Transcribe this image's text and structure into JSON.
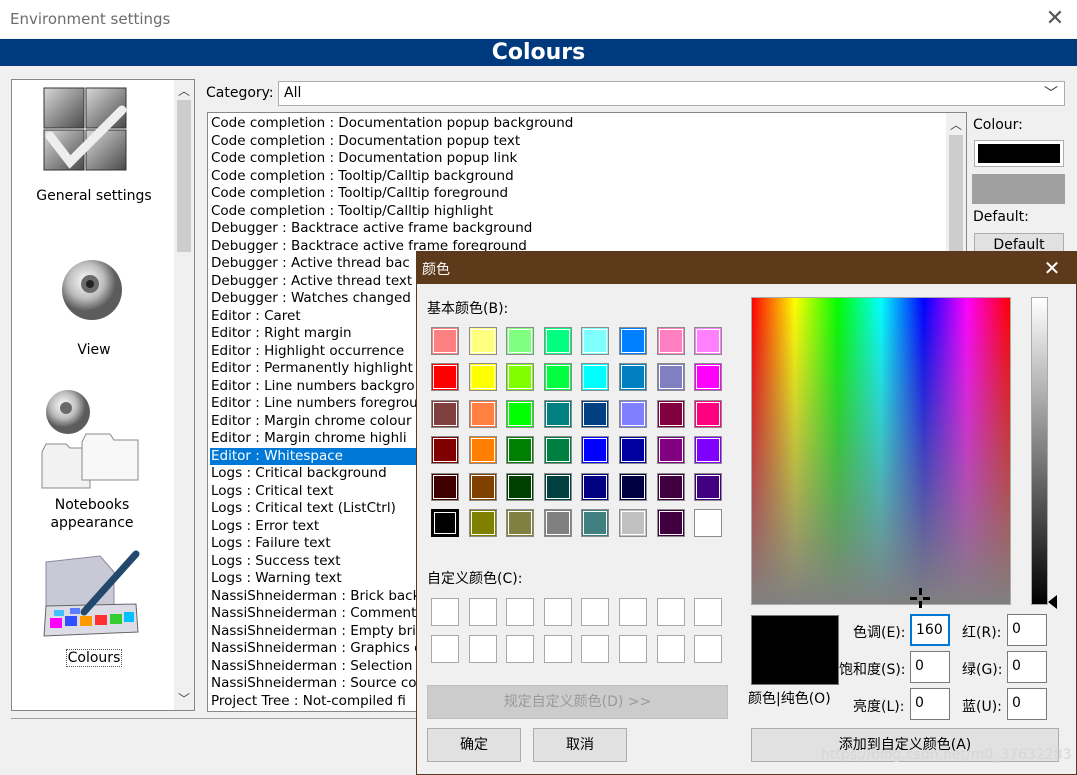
{
  "window": {
    "title": "Environment settings",
    "close_icon": "close-icon"
  },
  "header": {
    "title": "Colours"
  },
  "sidebar": {
    "items": [
      {
        "label": "General settings",
        "icon": "settings-check-icon"
      },
      {
        "label": "View",
        "icon": "eye-icon"
      },
      {
        "label": "Notebooks appearance",
        "icon": "notebooks-icon"
      },
      {
        "label": "Colours",
        "icon": "palette-icon"
      }
    ]
  },
  "category": {
    "label": "Category:",
    "value": "All"
  },
  "list": {
    "items": [
      "Code completion : Documentation popup background",
      "Code completion : Documentation popup text",
      "Code completion : Documentation popup link",
      "Code completion : Tooltip/Calltip background",
      "Code completion : Tooltip/Calltip foreground",
      "Code completion : Tooltip/Calltip highlight",
      "Debugger : Backtrace active frame background",
      "Debugger : Backtrace active frame foreground",
      "Debugger : Active thread bac",
      "Debugger : Active thread text",
      "Debugger : Watches changed",
      "Editor : Caret",
      "Editor : Right margin",
      "Editor : Highlight occurrence",
      "Editor : Permanently highlight",
      "Editor : Line numbers backgro",
      "Editor : Line numbers foregrou",
      "Editor : Margin chrome colour",
      "Editor : Margin chrome highli",
      "Editor : Whitespace",
      "Logs : Critical background",
      "Logs : Critical text",
      "Logs : Critical text (ListCtrl)",
      "Logs : Error text",
      "Logs : Failure text",
      "Logs : Success text",
      "Logs : Warning text",
      "NassiShneiderman : Brick back",
      "NassiShneiderman : Comment",
      "NassiShneiderman : Empty bri",
      "NassiShneiderman : Graphics c",
      "NassiShneiderman : Selection",
      "NassiShneiderman : Source co",
      "Project Tree : Not-compiled fi"
    ],
    "selected_index": 19
  },
  "right_panel": {
    "colour_label": "Colour:",
    "colour_value": "#000000",
    "default_label": "Default:",
    "default_button": "Default"
  },
  "color_dialog": {
    "title": "颜色",
    "basic_label": "基本颜色(B):",
    "custom_label": "自定义颜色(C):",
    "define_button": "规定自定义颜色(D) >>",
    "ok_button": "确定",
    "cancel_button": "取消",
    "add_button": "添加到自定义颜色(A)",
    "preview_label": "颜色|纯色(O)",
    "hue_label": "色调(E):",
    "hue_value": "160",
    "sat_label": "饱和度(S):",
    "sat_value": "0",
    "lum_label": "亮度(L):",
    "lum_value": "0",
    "red_label": "红(R):",
    "red_value": "0",
    "green_label": "绿(G):",
    "green_value": "0",
    "blue_label": "蓝(U):",
    "blue_value": "0",
    "watermark": "https://blog.csdn.net/m0_37632283",
    "basic_colors": [
      "#ff8080",
      "#ffff80",
      "#80ff80",
      "#00ff80",
      "#80ffff",
      "#0080ff",
      "#ff80c0",
      "#ff80ff",
      "#ff0000",
      "#ffff00",
      "#80ff00",
      "#00ff40",
      "#00ffff",
      "#0080c0",
      "#8080c0",
      "#ff00ff",
      "#804040",
      "#ff8040",
      "#00ff00",
      "#008080",
      "#004080",
      "#8080ff",
      "#800040",
      "#ff0080",
      "#800000",
      "#ff8000",
      "#008000",
      "#008040",
      "#0000ff",
      "#0000a0",
      "#800080",
      "#8000ff",
      "#400000",
      "#804000",
      "#004000",
      "#004040",
      "#000080",
      "#000040",
      "#400040",
      "#400080",
      "#000000",
      "#808000",
      "#808040",
      "#808080",
      "#408080",
      "#c0c0c0",
      "#400040",
      "#ffffff"
    ],
    "selected_basic_index": 40
  }
}
